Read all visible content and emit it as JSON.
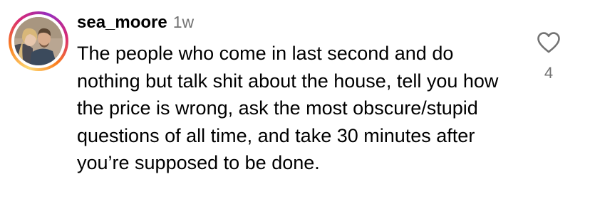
{
  "comment": {
    "username": "sea_moore",
    "time_ago": "1w",
    "text": "The people who come in last second and do nothing but talk shit about the house, tell you how the price is wrong, ask the most obscure/stupid questions of all time, and take 30 minutes after you’re supposed to be done.",
    "like_count": "4",
    "like_icon": "heart-outline-icon",
    "avatar_icon": "profile-photo",
    "story_ring_colors": [
      "#feda75",
      "#fa7e1e",
      "#d62976",
      "#962fbf"
    ]
  }
}
